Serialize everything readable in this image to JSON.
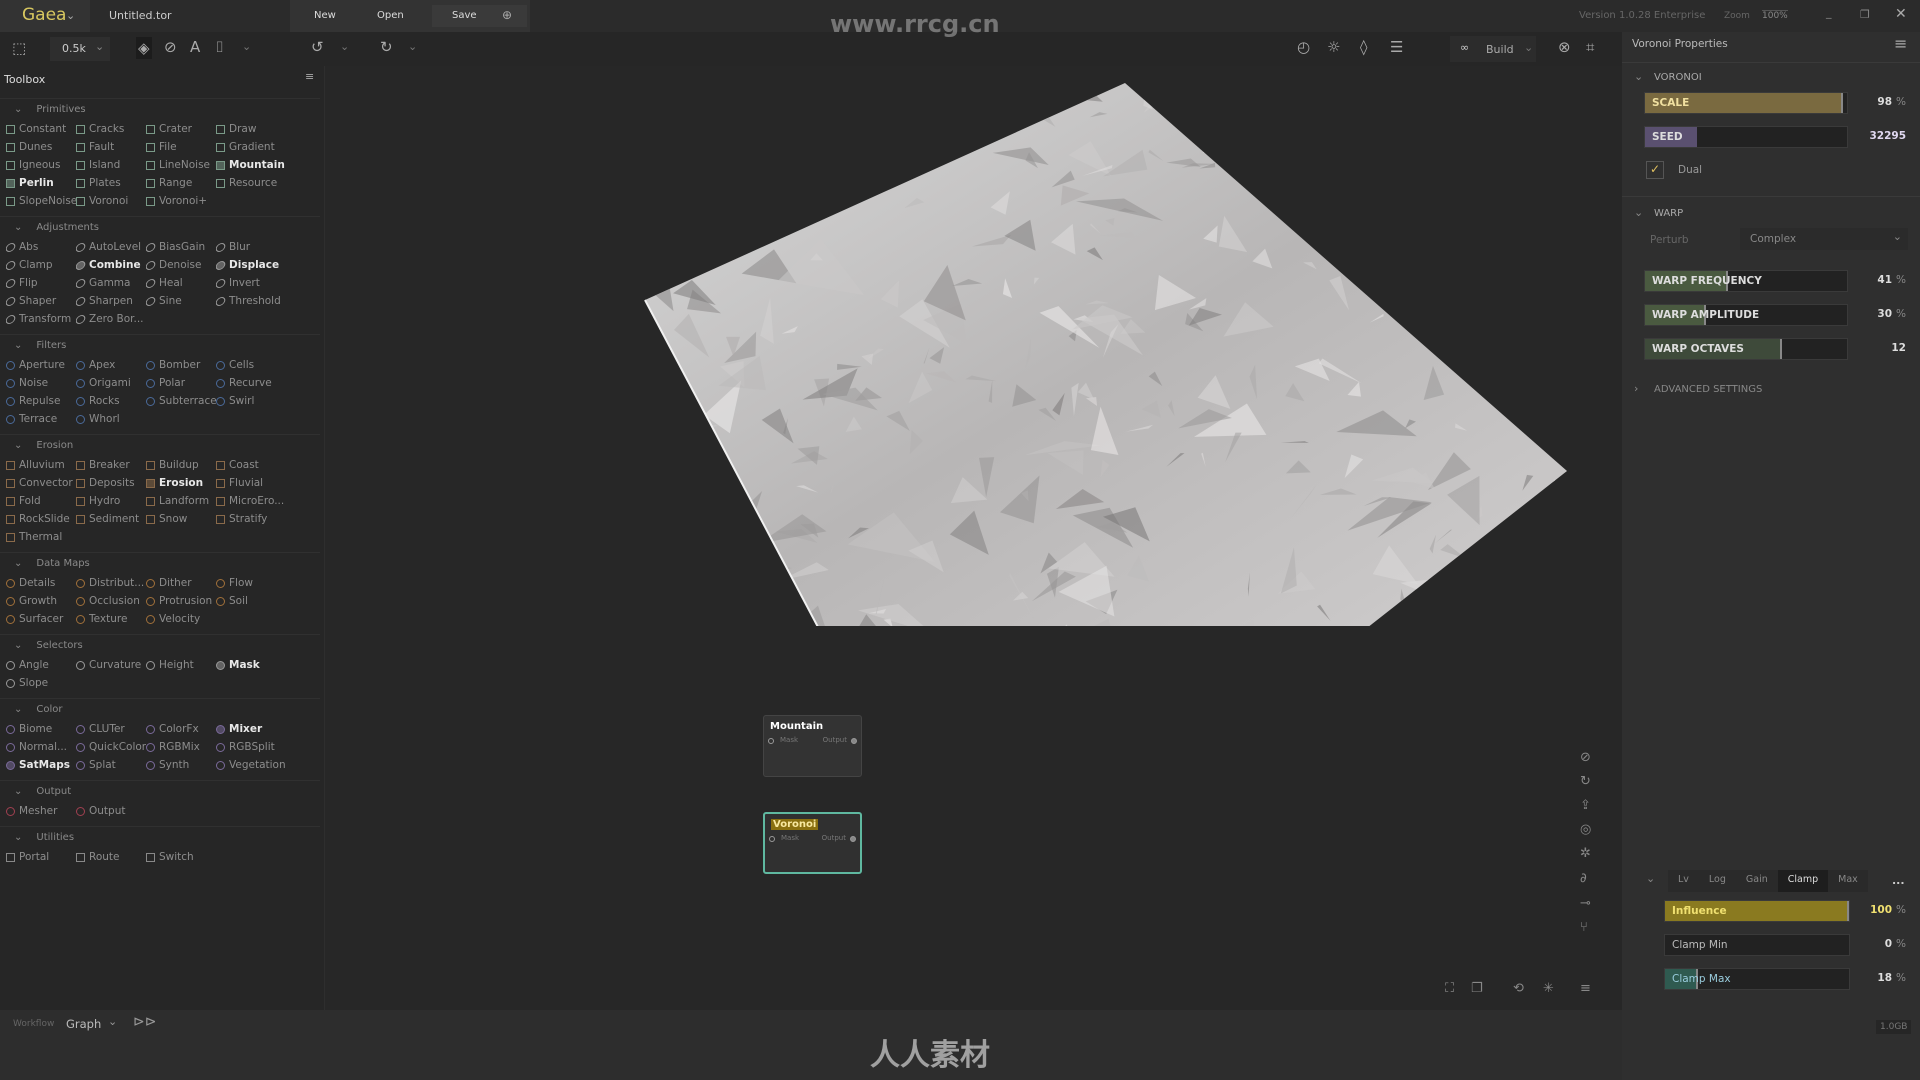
{
  "title_bar": {
    "app": "Gaea",
    "file": "Untitled.tor",
    "new": "New",
    "open": "Open",
    "save": "Save",
    "version": "Version 1.0.28 Enterprise",
    "zoom_label": "Zoom",
    "zoom_value": "100%"
  },
  "toolbar": {
    "resolution": "0.5k",
    "build": "Build"
  },
  "watermark": {
    "top": "www.rrcg.cn",
    "bottom": "人人素材"
  },
  "toolbox": {
    "title": "Toolbox",
    "sections": [
      {
        "name": "Primitives",
        "shape": "square",
        "color": "#7a9a88",
        "items": [
          [
            "Constant",
            0
          ],
          [
            "Cracks",
            0
          ],
          [
            "Crater",
            0
          ],
          [
            "Draw",
            0
          ],
          [
            "Dunes",
            0
          ],
          [
            "Fault",
            0
          ],
          [
            "File",
            0
          ],
          [
            "Gradient",
            0
          ],
          [
            "Igneous",
            0
          ],
          [
            "Island",
            0
          ],
          [
            "LineNoise",
            0
          ],
          [
            "Mountain",
            1
          ],
          [
            "Perlin",
            1
          ],
          [
            "Plates",
            0
          ],
          [
            "Range",
            0
          ],
          [
            "Resource",
            0
          ],
          [
            "SlopeNoise",
            0
          ],
          [
            "Voronoi",
            0
          ],
          [
            "Voronoi+",
            0
          ]
        ]
      },
      {
        "name": "Adjustments",
        "shape": "ellipse",
        "color": "#9a9a9a",
        "items": [
          [
            "Abs",
            0
          ],
          [
            "AutoLevel",
            0
          ],
          [
            "BiasGain",
            0
          ],
          [
            "Blur",
            0
          ],
          [
            "Clamp",
            0
          ],
          [
            "Combine",
            1
          ],
          [
            "Denoise",
            0
          ],
          [
            "Displace",
            1
          ],
          [
            "Flip",
            0
          ],
          [
            "Gamma",
            0
          ],
          [
            "Heal",
            0
          ],
          [
            "Invert",
            0
          ],
          [
            "Shaper",
            0
          ],
          [
            "Sharpen",
            0
          ],
          [
            "Sine",
            0
          ],
          [
            "Threshold",
            0
          ],
          [
            "Transform",
            0
          ],
          [
            "Zero Bor...",
            0
          ]
        ]
      },
      {
        "name": "Filters",
        "shape": "circle",
        "color": "#4a6a9a",
        "items": [
          [
            "Aperture",
            0
          ],
          [
            "Apex",
            0
          ],
          [
            "Bomber",
            0
          ],
          [
            "Cells",
            0
          ],
          [
            "Noise",
            0
          ],
          [
            "Origami",
            0
          ],
          [
            "Polar",
            0
          ],
          [
            "Recurve",
            0
          ],
          [
            "Repulse",
            0
          ],
          [
            "Rocks",
            0
          ],
          [
            "Subterrace",
            0
          ],
          [
            "Swirl",
            0
          ],
          [
            "Terrace",
            0
          ],
          [
            "Whorl",
            0
          ]
        ]
      },
      {
        "name": "Erosion",
        "shape": "square",
        "color": "#8a6a4a",
        "items": [
          [
            "Alluvium",
            0
          ],
          [
            "Breaker",
            0
          ],
          [
            "Buildup",
            0
          ],
          [
            "Coast",
            0
          ],
          [
            "Convector",
            0
          ],
          [
            "Deposits",
            0
          ],
          [
            "Erosion",
            1
          ],
          [
            "Fluvial",
            0
          ],
          [
            "Fold",
            0
          ],
          [
            "Hydro",
            0
          ],
          [
            "Landform",
            0
          ],
          [
            "MicroEro...",
            0
          ],
          [
            "RockSlide",
            0
          ],
          [
            "Sediment",
            0
          ],
          [
            "Snow",
            0
          ],
          [
            "Stratify",
            0
          ],
          [
            "Thermal",
            0
          ]
        ]
      },
      {
        "name": "Data Maps",
        "shape": "circle",
        "color": "#a0703a",
        "items": [
          [
            "Details",
            0
          ],
          [
            "Distribut...",
            0
          ],
          [
            "Dither",
            0
          ],
          [
            "Flow",
            0
          ],
          [
            "Growth",
            0
          ],
          [
            "Occlusion",
            0
          ],
          [
            "Protrusion",
            0
          ],
          [
            "Soil",
            0
          ],
          [
            "Surfacer",
            0
          ],
          [
            "Texture",
            0
          ],
          [
            "Velocity",
            0
          ]
        ]
      },
      {
        "name": "Selectors",
        "shape": "circle",
        "color": "#999999",
        "items": [
          [
            "Angle",
            0
          ],
          [
            "Curvature",
            0
          ],
          [
            "Height",
            0
          ],
          [
            "Mask",
            1
          ],
          [
            "Slope",
            0
          ]
        ]
      },
      {
        "name": "Color",
        "shape": "circle",
        "color": "#7a6a9a",
        "items": [
          [
            "Biome",
            0
          ],
          [
            "CLUTer",
            0
          ],
          [
            "ColorFx",
            0
          ],
          [
            "Mixer",
            1
          ],
          [
            "Normal...",
            0
          ],
          [
            "QuickColor",
            0
          ],
          [
            "RGBMix",
            0
          ],
          [
            "RGBSplit",
            0
          ],
          [
            "SatMaps",
            1
          ],
          [
            "Splat",
            0
          ],
          [
            "Synth",
            0
          ],
          [
            "Vegetation",
            0
          ]
        ]
      },
      {
        "name": "Output",
        "shape": "circle",
        "color": "#a04050",
        "items": [
          [
            "Mesher",
            0
          ],
          [
            "Output",
            0
          ]
        ]
      },
      {
        "name": "Utilities",
        "shape": "square",
        "color": "#888888",
        "items": [
          [
            "Portal",
            0
          ],
          [
            "Route",
            0
          ],
          [
            "Switch",
            0
          ]
        ]
      }
    ]
  },
  "bottom_bar": {
    "workflow_label": "Workflow",
    "workflow_value": "Graph"
  },
  "graph": {
    "nodes": [
      {
        "title": "Mountain",
        "in": "Mask",
        "out": "Output",
        "selected": false
      },
      {
        "title": "Voronoi",
        "in": "Mask",
        "out": "Output",
        "selected": true
      }
    ]
  },
  "properties": {
    "title": "Voronoi Properties",
    "voronoi_header": "VORONOI",
    "scale": {
      "label": "SCALE",
      "value": 98,
      "unit": "%",
      "color": "#7a6a40"
    },
    "seed": {
      "label": "SEED",
      "value": 32295,
      "color": "#5a5070"
    },
    "dual": {
      "label": "Dual",
      "checked": true
    },
    "warp_header": "WARP",
    "perturb_label": "Perturb",
    "perturb_value": "Complex",
    "warp_frequency": {
      "label": "WARP FREQUENCY",
      "value": 41,
      "unit": "%",
      "color": "#4a5a40"
    },
    "warp_amplitude": {
      "label": "WARP AMPLITUDE",
      "value": 30,
      "unit": "%",
      "color": "#4a5a40"
    },
    "warp_octaves": {
      "label": "WARP OCTAVES",
      "value": 12,
      "fraction": 0.68,
      "color": "#3e4a3a"
    },
    "advanced": "ADVANCED SETTINGS",
    "tabs": [
      "Lv",
      "Log",
      "Gain",
      "Clamp",
      "Max"
    ],
    "active_tab": "Clamp",
    "more": "...",
    "influence": {
      "label": "Influence",
      "value": 100,
      "unit": "%",
      "color": "#8a7a20"
    },
    "clamp_min": {
      "label": "Clamp Min",
      "value": 0,
      "unit": "%"
    },
    "clamp_max": {
      "label": "Clamp Max",
      "value": 18,
      "unit": "%",
      "color": "#2f5a50"
    },
    "memory": "1.0GB"
  }
}
